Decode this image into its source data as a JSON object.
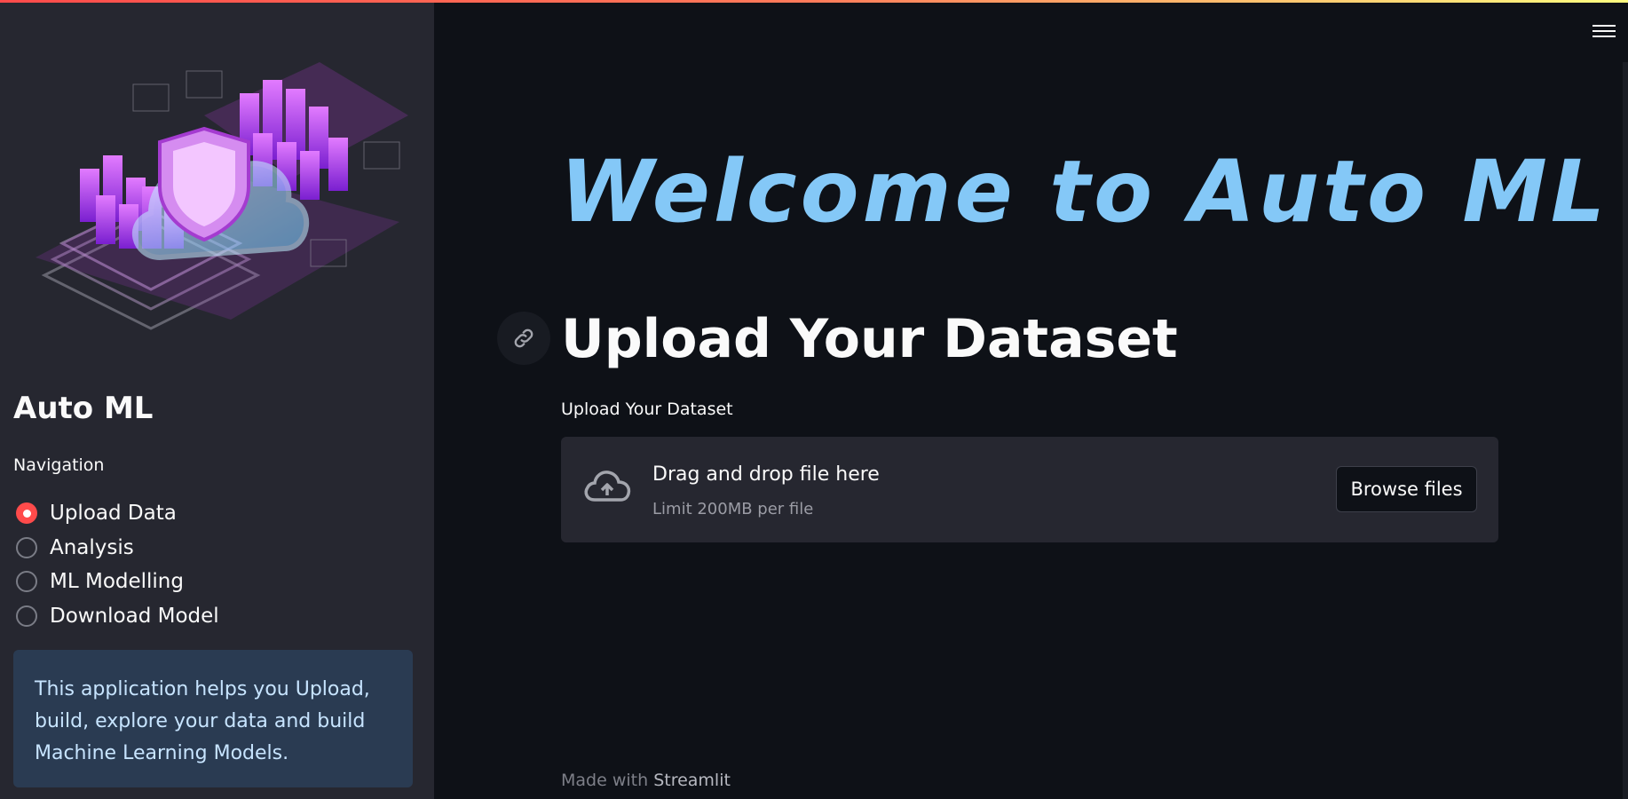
{
  "colors": {
    "sidebar_bg": "#262730",
    "main_bg": "#0e1117",
    "accent": "#ff4b4b",
    "welcome_text": "#84c8f7",
    "info_bg": "#2a3b52",
    "info_text": "#c7e4ff"
  },
  "sidebar": {
    "hero_image": "cloud-security-datacenter-illustration",
    "title": "Auto ML",
    "nav_label": "Navigation",
    "nav_items": [
      {
        "label": "Upload Data",
        "selected": true
      },
      {
        "label": "Analysis",
        "selected": false
      },
      {
        "label": "ML Modelling",
        "selected": false
      },
      {
        "label": "Download Model",
        "selected": false
      }
    ],
    "info_text": "This application helps you Upload, build, explore your data and build Machine Learning Models."
  },
  "main": {
    "welcome": "Welcome to Auto ML",
    "section_title": "Upload Your Dataset",
    "uploader": {
      "label": "Upload Your Dataset",
      "drop_title": "Drag and drop file here",
      "limit": "Limit 200MB per file",
      "button": "Browse files",
      "icon": "cloud-upload-icon"
    },
    "anchor_icon": "link-icon",
    "menu_icon": "hamburger-menu-icon",
    "footer": {
      "prefix": "Made with",
      "brand": "Streamlit"
    }
  }
}
